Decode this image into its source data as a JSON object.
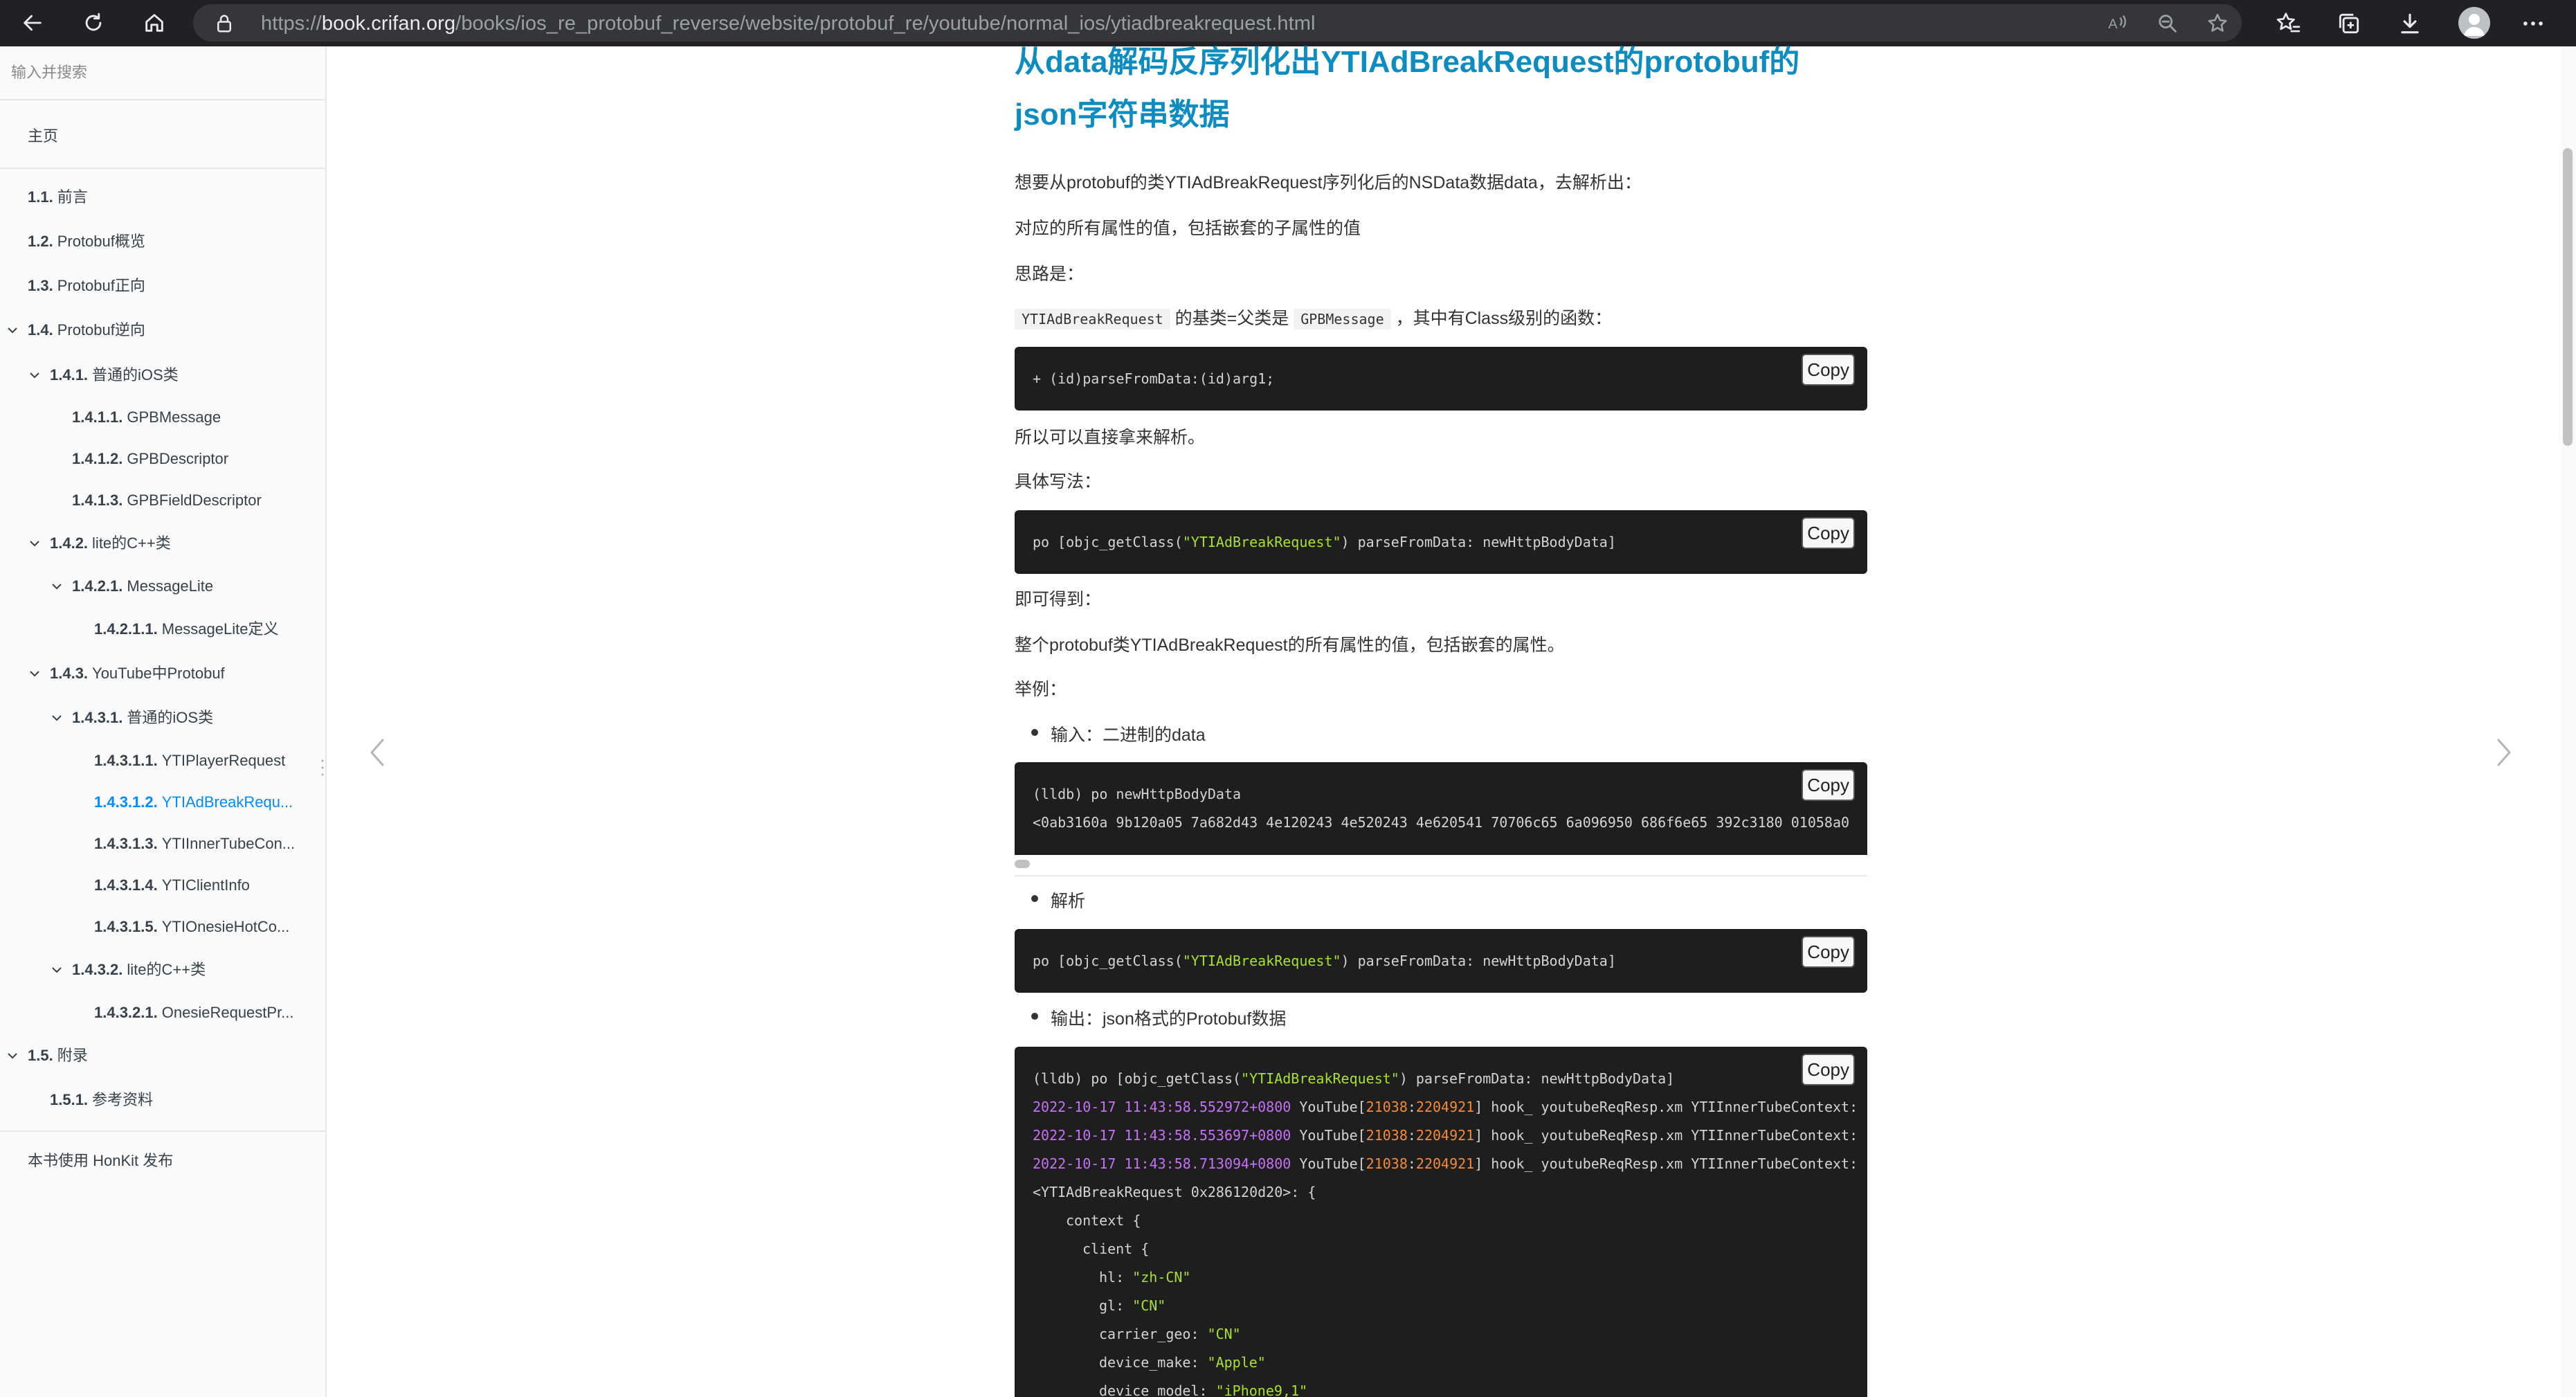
{
  "browser": {
    "url_prefix": "https://",
    "url_domain": "book.crifan.org",
    "url_path": "/books/ios_re_protobuf_reverse/website/protobuf_re/youtube/normal_ios/ytiadbreakrequest.html",
    "icons": {
      "back": "arrow-left-icon",
      "refresh": "refresh-icon",
      "home": "home-icon",
      "lock": "lock-icon",
      "read_aloud": "read-aloud-icon",
      "zoom": "zoom-icon",
      "favorite_add": "star-add-icon",
      "favorites": "favorites-icon",
      "collections": "collections-icon",
      "downloads": "download-icon",
      "profile": "profile-avatar-icon",
      "more": "more-icon"
    }
  },
  "sidebar": {
    "search_placeholder": "输入并搜索",
    "home": "主页",
    "items": [
      {
        "num": "1.1.",
        "label": "前言"
      },
      {
        "num": "1.2.",
        "label": "Protobuf概览"
      },
      {
        "num": "1.3.",
        "label": "Protobuf正向"
      },
      {
        "num": "1.4.",
        "label": "Protobuf逆向"
      },
      {
        "num": "1.4.1.",
        "label": "普通的iOS类"
      },
      {
        "num": "1.4.1.1.",
        "label": "GPBMessage"
      },
      {
        "num": "1.4.1.2.",
        "label": "GPBDescriptor"
      },
      {
        "num": "1.4.1.3.",
        "label": "GPBFieldDescriptor"
      },
      {
        "num": "1.4.2.",
        "label": "lite的C++类"
      },
      {
        "num": "1.4.2.1.",
        "label": "MessageLite"
      },
      {
        "num": "1.4.2.1.1.",
        "label": "MessageLite定义"
      },
      {
        "num": "1.4.3.",
        "label": "YouTube中Protobuf"
      },
      {
        "num": "1.4.3.1.",
        "label": "普通的iOS类"
      },
      {
        "num": "1.4.3.1.1.",
        "label": "YTIPlayerRequest"
      },
      {
        "num": "1.4.3.1.2.",
        "label": "YTIAdBreakRequ..."
      },
      {
        "num": "1.4.3.1.3.",
        "label": "YTIInnerTubeCon..."
      },
      {
        "num": "1.4.3.1.4.",
        "label": "YTIClientInfo"
      },
      {
        "num": "1.4.3.1.5.",
        "label": "YTIOnesieHotCo..."
      },
      {
        "num": "1.4.3.2.",
        "label": "lite的C++类"
      },
      {
        "num": "1.4.3.2.1.",
        "label": "OnesieRequestPr..."
      },
      {
        "num": "1.5.",
        "label": "附录"
      },
      {
        "num": "1.5.1.",
        "label": "参考资料"
      }
    ],
    "footer": "本书使用 HonKit 发布",
    "active_color": "#008cff"
  },
  "content": {
    "title_line1": "从data解码反序列化出YTIAdBreakRequest的protobuf的",
    "title_line2": "json字符串数据",
    "p1": "想要从protobuf的类YTIAdBreakRequest序列化后的NSData数据data，去解析出：",
    "p2": "对应的所有属性的值，包括嵌套的子属性的值",
    "p3": "思路是：",
    "p4_code1": "YTIAdBreakRequest",
    "p4_text1": " 的基类=父类是 ",
    "p4_code2": "GPBMessage",
    "p4_text2": " ，其中有Class级别的函数：",
    "code1": "+ (id)parseFromData:(id)arg1;",
    "p5": "所以可以直接拿来解析。",
    "p6": "具体写法：",
    "code2_a": "po [objc_getClass(",
    "code2_str": "\"YTIAdBreakRequest\"",
    "code2_b": ") parseFromData: newHttpBodyData]",
    "p7": "即可得到：",
    "p8": "整个protobuf类YTIAdBreakRequest的所有属性的值，包括嵌套的属性。",
    "p9": "举例：",
    "bullet1": "输入：二进制的data",
    "code3_line1": "(lldb) po newHttpBodyData",
    "code3_line2": "<0ab3160a 9b120a05 7a682d43 4e120243 4e520243 4e620541 70706c65 6a096950 686f6e65 392c3180 01058a0",
    "bullet2": "解析",
    "code4_a": "po [objc_getClass(",
    "code4_str": "\"YTIAdBreakRequest\"",
    "code4_b": ") parseFromData: newHttpBodyData]",
    "bullet3": "输出：json格式的Protobuf数据",
    "code5": {
      "cmd_a": "(lldb) po [objc_getClass(",
      "cmd_str": "\"YTIAdBreakRequest\"",
      "cmd_b": ") parseFromData: newHttpBodyData]",
      "log_lines": [
        {
          "ts": "2022-10-17 11:43:58.552972+0800",
          "app": " YouTube[",
          "n1": "21038",
          "colon": ":",
          "n2": "2204921",
          "rest": "] hook_ youtubeReqResp.xm YTIInnerTubeContext:"
        },
        {
          "ts": "2022-10-17 11:43:58.553697+0800",
          "app": " YouTube[",
          "n1": "21038",
          "colon": ":",
          "n2": "2204921",
          "rest": "] hook_ youtubeReqResp.xm YTIInnerTubeContext:"
        },
        {
          "ts": "2022-10-17 11:43:58.713094+0800",
          "app": " YouTube[",
          "n1": "21038",
          "colon": ":",
          "n2": "2204921",
          "rest": "] hook_ youtubeReqResp.xm YTIInnerTubeContext:"
        }
      ],
      "obj_line": "<YTIAdBreakRequest 0x286120d20>: {",
      "context": "context {",
      "client": "client {",
      "fields": [
        {
          "key": "hl: ",
          "val": "\"zh-CN\""
        },
        {
          "key": "gl: ",
          "val": "\"CN\""
        },
        {
          "key": "carrier_geo: ",
          "val": "\"CN\""
        },
        {
          "key": "device_make: ",
          "val": "\"Apple\""
        },
        {
          "key": "device_model: ",
          "val": "\"iPhone9,1\""
        }
      ]
    },
    "copy_label": "Copy"
  }
}
